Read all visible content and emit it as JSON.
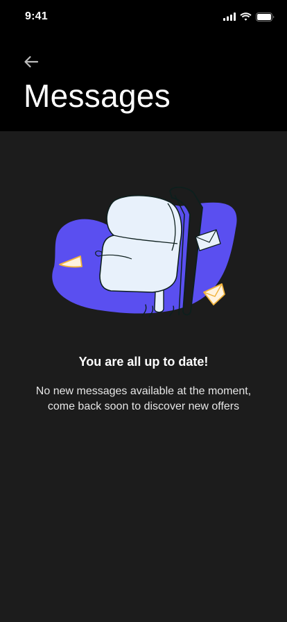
{
  "status_bar": {
    "time": "9:41",
    "icons": [
      "signal-icon",
      "wifi-icon",
      "battery-icon"
    ]
  },
  "header": {
    "back_icon": "arrow-left-icon",
    "title": "Messages"
  },
  "empty_state": {
    "illustration": "mailbox-illustration",
    "title": "You are all up to date!",
    "description": "No new messages available at the moment, come back soon to discover new offers"
  },
  "colors": {
    "header_bg": "#000000",
    "content_bg": "#1c1c1c",
    "blob": "#5a4ff0",
    "mailbox": "#e8f1fb",
    "envelope_accent": "#f0b23a"
  }
}
